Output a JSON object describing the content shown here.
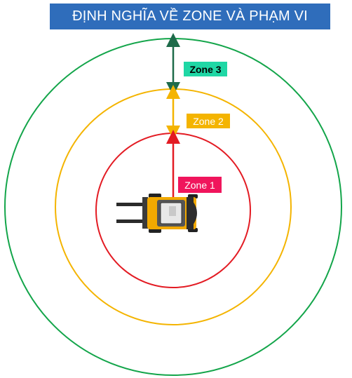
{
  "title": {
    "text": "ĐỊNH NGHĨA VỀ ZONE VÀ PHẠM VI",
    "background": "#2f6dbb",
    "color": "#ffffff"
  },
  "zones": [
    {
      "id": "zone3",
      "label": "Zone 3",
      "ring_color": "#13a54a",
      "label_bg": "#1fd7a5",
      "label_color": "#000000",
      "arrow_color": "#1e6b4a"
    },
    {
      "id": "zone2",
      "label": "Zone 2",
      "ring_color": "#f4b400",
      "label_bg": "#f4b400",
      "label_color": "#ffffff",
      "arrow_color": "#f4b400"
    },
    {
      "id": "zone1",
      "label": "Zone 1",
      "ring_color": "#e31b23",
      "label_bg": "#f0155c",
      "label_color": "#ffffff",
      "arrow_color": "#e31b23"
    }
  ],
  "icons": {
    "vehicle": "forklift-icon"
  }
}
